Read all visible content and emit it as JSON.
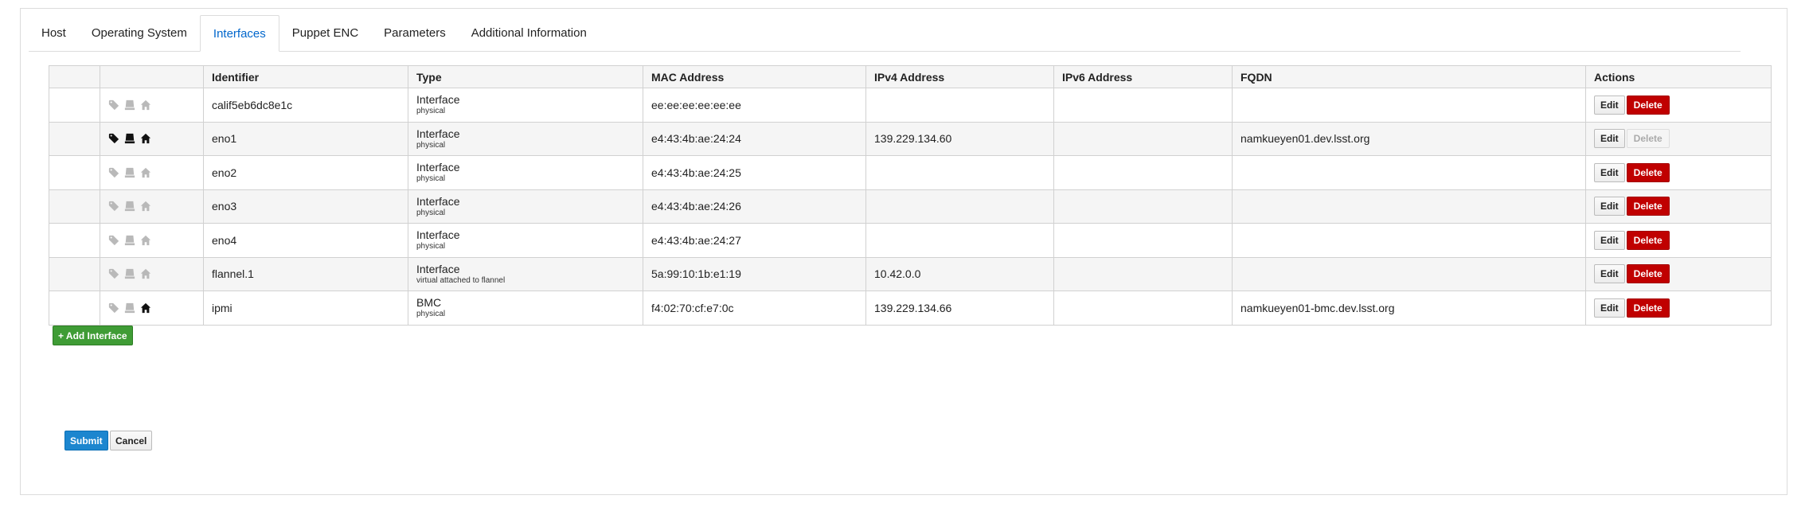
{
  "tabs": [
    {
      "label": "Host",
      "active": false
    },
    {
      "label": "Operating System",
      "active": false
    },
    {
      "label": "Interfaces",
      "active": true
    },
    {
      "label": "Puppet ENC",
      "active": false
    },
    {
      "label": "Parameters",
      "active": false
    },
    {
      "label": "Additional Information",
      "active": false
    }
  ],
  "table": {
    "headers": {
      "identifier": "Identifier",
      "type": "Type",
      "mac": "MAC Address",
      "ipv4": "IPv4 Address",
      "ipv6": "IPv6 Address",
      "fqdn": "FQDN",
      "actions": "Actions"
    },
    "rows": [
      {
        "icons": {
          "tag": "off",
          "server": "off",
          "home": "off"
        },
        "identifier": "calif5eb6dc8e1c",
        "type": "Interface",
        "type_detail": "physical",
        "mac": "ee:ee:ee:ee:ee:ee",
        "ipv4": "",
        "ipv6": "",
        "fqdn": "",
        "edit_label": "Edit",
        "delete_label": "Delete",
        "delete_enabled": true
      },
      {
        "icons": {
          "tag": "on",
          "server": "on",
          "home": "on"
        },
        "identifier": "eno1",
        "type": "Interface",
        "type_detail": "physical",
        "mac": "e4:43:4b:ae:24:24",
        "ipv4": "139.229.134.60",
        "ipv6": "",
        "fqdn": "namkueyen01.dev.lsst.org",
        "edit_label": "Edit",
        "delete_label": "Delete",
        "delete_enabled": false
      },
      {
        "icons": {
          "tag": "off",
          "server": "off",
          "home": "off"
        },
        "identifier": "eno2",
        "type": "Interface",
        "type_detail": "physical",
        "mac": "e4:43:4b:ae:24:25",
        "ipv4": "",
        "ipv6": "",
        "fqdn": "",
        "edit_label": "Edit",
        "delete_label": "Delete",
        "delete_enabled": true
      },
      {
        "icons": {
          "tag": "off",
          "server": "off",
          "home": "off"
        },
        "identifier": "eno3",
        "type": "Interface",
        "type_detail": "physical",
        "mac": "e4:43:4b:ae:24:26",
        "ipv4": "",
        "ipv6": "",
        "fqdn": "",
        "edit_label": "Edit",
        "delete_label": "Delete",
        "delete_enabled": true
      },
      {
        "icons": {
          "tag": "off",
          "server": "off",
          "home": "off"
        },
        "identifier": "eno4",
        "type": "Interface",
        "type_detail": "physical",
        "mac": "e4:43:4b:ae:24:27",
        "ipv4": "",
        "ipv6": "",
        "fqdn": "",
        "edit_label": "Edit",
        "delete_label": "Delete",
        "delete_enabled": true
      },
      {
        "icons": {
          "tag": "off",
          "server": "off",
          "home": "off"
        },
        "identifier": "flannel.1",
        "type": "Interface",
        "type_detail": "virtual attached to flannel",
        "mac": "5a:99:10:1b:e1:19",
        "ipv4": "10.42.0.0",
        "ipv6": "",
        "fqdn": "",
        "edit_label": "Edit",
        "delete_label": "Delete",
        "delete_enabled": true
      },
      {
        "icons": {
          "tag": "off",
          "server": "off",
          "home": "on"
        },
        "identifier": "ipmi",
        "type": "BMC",
        "type_detail": "physical",
        "mac": "f4:02:70:cf:e7:0c",
        "ipv4": "139.229.134.66",
        "ipv6": "",
        "fqdn": "namkueyen01-bmc.dev.lsst.org",
        "edit_label": "Edit",
        "delete_label": "Delete",
        "delete_enabled": true
      }
    ]
  },
  "buttons": {
    "add_interface": "+ Add Interface",
    "submit": "Submit",
    "cancel": "Cancel"
  }
}
